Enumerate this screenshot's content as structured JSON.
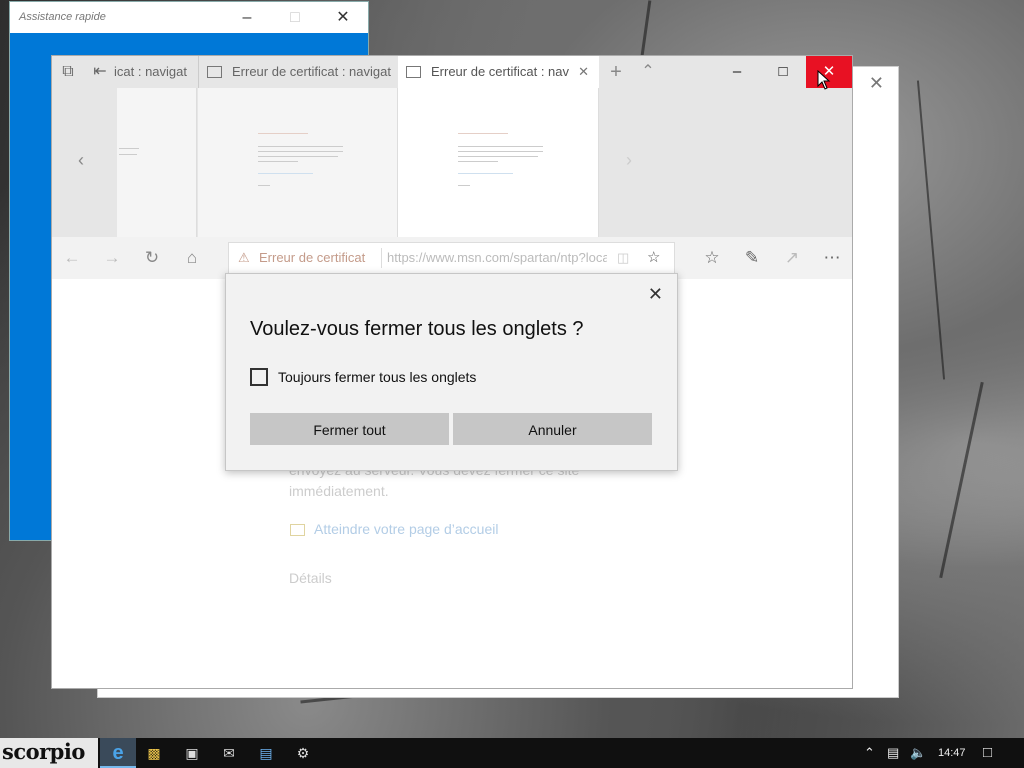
{
  "quick_assist": {
    "title": "Assistance rapide"
  },
  "edge": {
    "tabs": [
      {
        "label": "icat : navigat"
      },
      {
        "label": "Erreur de certificat : navigat"
      },
      {
        "label": "Erreur de certificat : nav"
      }
    ],
    "address": {
      "cert_label": "Erreur de certificat",
      "url": "https://www.msn.com/spartan/ntp?locale=fr-fr"
    },
    "content": {
      "line1": "envoyez au serveur. Vous devez fermer ce site",
      "line2": "immédiatement.",
      "home_link": "Atteindre votre page d’accueil",
      "details": "Détails"
    }
  },
  "dialog": {
    "title": "Voulez-vous fermer tous les onglets ?",
    "checkbox_label": "Toujours fermer tous les onglets",
    "close_all": "Fermer tout",
    "cancel": "Annuler"
  },
  "taskbar": {
    "brand": "scorpio",
    "clock": "14:47"
  },
  "colors": {
    "accent": "#0078d7",
    "close_red": "#e81123"
  }
}
